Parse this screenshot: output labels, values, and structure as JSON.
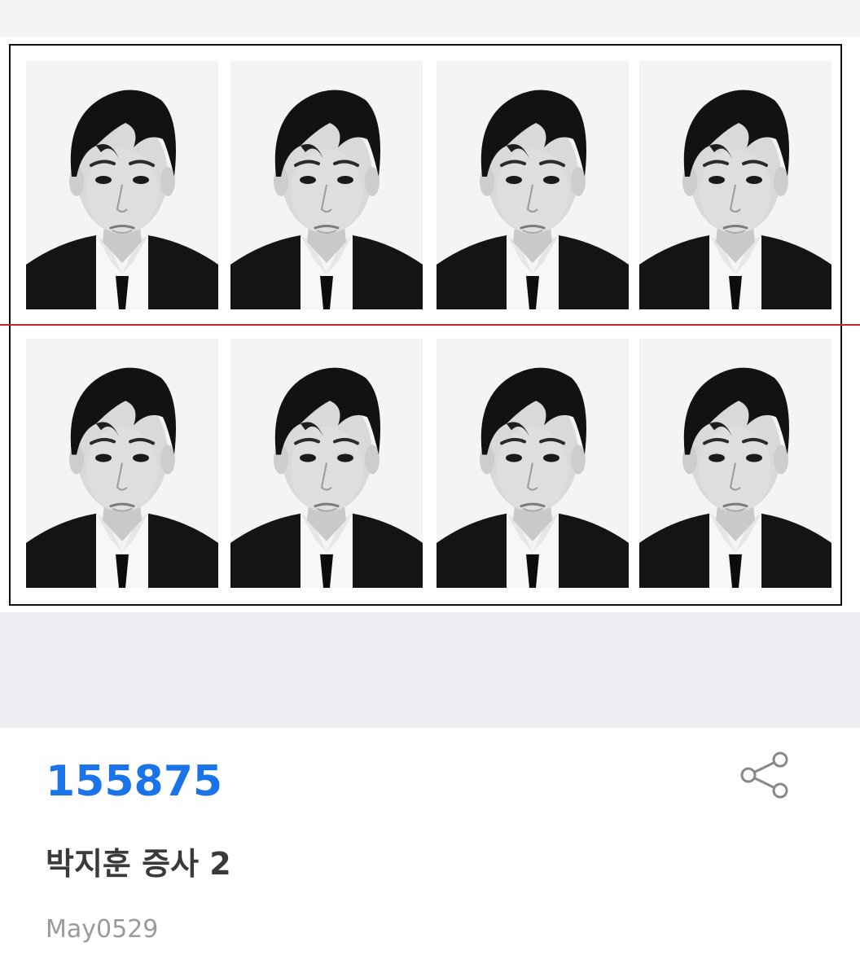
{
  "post": {
    "number": "155875",
    "title": "박지훈 증사 2",
    "author": "May0529"
  },
  "share": {
    "icon": "share-icon"
  },
  "photo_sheet": {
    "rows": 2,
    "columns": 4,
    "photo_style": "black-and-white ID photo, dark suit, white shirt, black tie",
    "cut_line_color": "#c62828"
  },
  "colors": {
    "accent": "#1a73e8",
    "title": "#3a3a3a",
    "author": "#9a9a9a"
  }
}
